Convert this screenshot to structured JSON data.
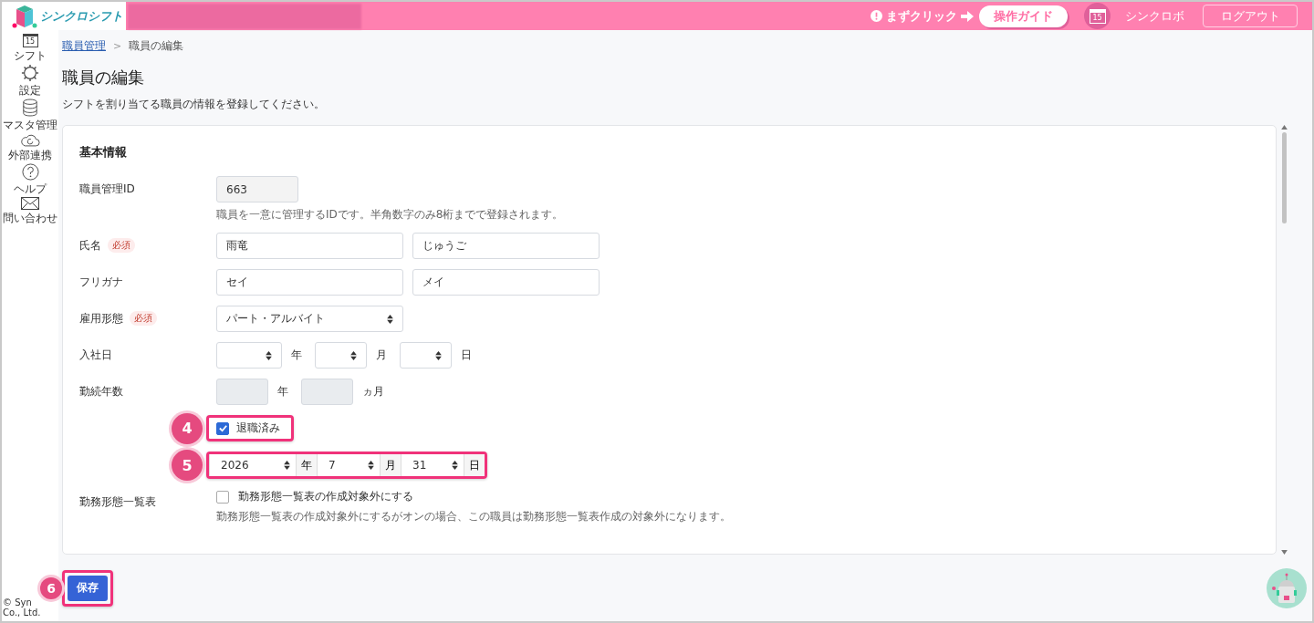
{
  "header": {
    "app_name": "シンクロシフト",
    "hint": "まずクリック",
    "guide_button": "操作ガイド",
    "calendar_day": "15",
    "user": "シンクロボ",
    "logout_button": "ログアウト"
  },
  "sidebar": {
    "items": [
      {
        "kind": "calendar",
        "label": "シフト",
        "day": "15"
      },
      {
        "kind": "gear",
        "label": "設定"
      },
      {
        "kind": "database",
        "label": "マスタ管理"
      },
      {
        "kind": "cloud",
        "label": "外部連携"
      },
      {
        "kind": "help",
        "label": "ヘルプ"
      },
      {
        "kind": "mail",
        "label": "問い合わせ"
      }
    ],
    "copyright": [
      "© Syn",
      "Co., Ltd."
    ]
  },
  "breadcrumb": [
    {
      "label": "職員管理",
      "link": true
    },
    {
      "label": ">",
      "kind": "separator"
    },
    {
      "label": "職員の編集",
      "link": false
    }
  ],
  "title": "職員の編集",
  "description": "シフトを割り当てる職員の情報を登録してください。",
  "section_title": "基本情報",
  "rows": [
    {
      "kind": "id",
      "label": "職員管理ID",
      "value": "663",
      "hint": "職員を一意に管理するIDです。半角数字のみ8桁までで登録されます。"
    },
    {
      "kind": "pair",
      "label": "氏名",
      "required": "必須",
      "values": [
        "雨竜",
        "じゅうご"
      ]
    },
    {
      "kind": "pair",
      "label": "フリガナ",
      "values": [
        "セイ",
        "メイ"
      ]
    },
    {
      "kind": "select",
      "label": "雇用形態",
      "required": "必須",
      "value": "パート・アルバイト"
    },
    {
      "kind": "date",
      "label": "入社日",
      "parts": [
        {
          "unit": "年"
        },
        {
          "unit": "月"
        },
        {
          "unit": "日"
        }
      ]
    },
    {
      "kind": "tenure",
      "label": "勤続年数",
      "parts": [
        {
          "unit": "年"
        },
        {
          "unit": "ヵ月"
        }
      ]
    },
    {
      "kind": "check",
      "text": "退職済み",
      "checked": true,
      "badge": "4"
    },
    {
      "kind": "dategroup",
      "badge": "5",
      "parts": [
        {
          "value": "2026",
          "unit": "年"
        },
        {
          "value": "7",
          "unit": "月"
        },
        {
          "value": "31",
          "unit": "日"
        }
      ]
    },
    {
      "kind": "check",
      "label": "勤務形態一覧表",
      "text": "勤務形態一覧表の作成対象外にする",
      "checked": false,
      "hint": "勤務形態一覧表の作成対象外にするがオンの場合、この職員は勤務形態一覧表作成の対象外になります。"
    }
  ],
  "save_button": {
    "label": "保存",
    "badge": "6"
  }
}
